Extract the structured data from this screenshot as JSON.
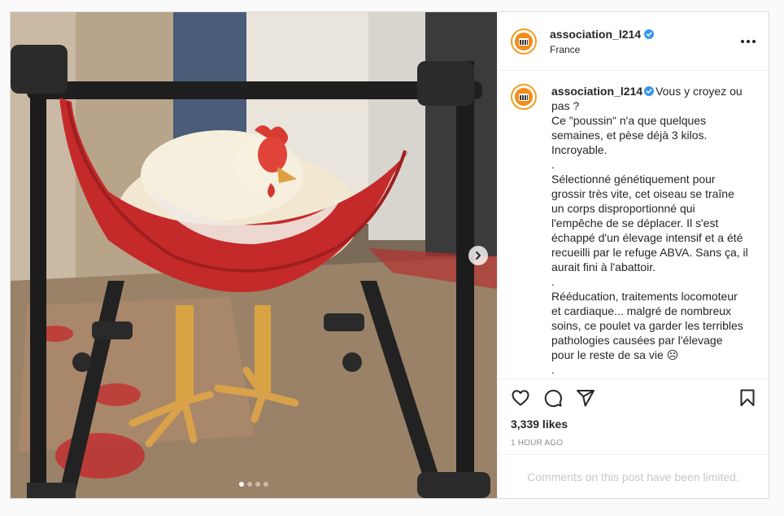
{
  "post": {
    "username": "association_l214",
    "location": "France",
    "caption_lines": [
      "Vous y croyez ou",
      "pas ?",
      "Ce \"poussin\" n'a que quelques",
      "semaines, et pèse déjà 3 kilos.",
      "Incroyable.",
      ".",
      "Sélectionné génétiquement pour",
      "grossir très vite, cet oiseau se traîne",
      "un corps disproportionné qui",
      "l'empêche de se déplacer. Il s'est",
      "échappé d'un élevage intensif et a été",
      "recueilli par le refuge ABVA. Sans ça, il",
      "aurait fini à l'abattoir.",
      ".",
      "Rééducation, traitements locomoteur",
      "et cardiaque... malgré de nombreux",
      "soins, ce poulet va garder les terribles",
      "pathologies causées par l'élevage",
      "pour le reste de sa vie ☹",
      "."
    ],
    "likes": "3,339 likes",
    "time": "1 HOUR AGO",
    "comments_notice": "Comments on this post have been limited.",
    "carousel": {
      "slide_count": 4,
      "active_index": 0
    }
  },
  "colors": {
    "verified": "#3897f0",
    "avatar_ring": "#f0a020",
    "avatar_fill": "#f28c1a"
  },
  "icons": {
    "more": "more-horizontal-icon",
    "like": "heart-icon",
    "comment": "comment-bubble-icon",
    "share": "paper-plane-icon",
    "save": "bookmark-icon",
    "next": "chevron-right-icon"
  }
}
